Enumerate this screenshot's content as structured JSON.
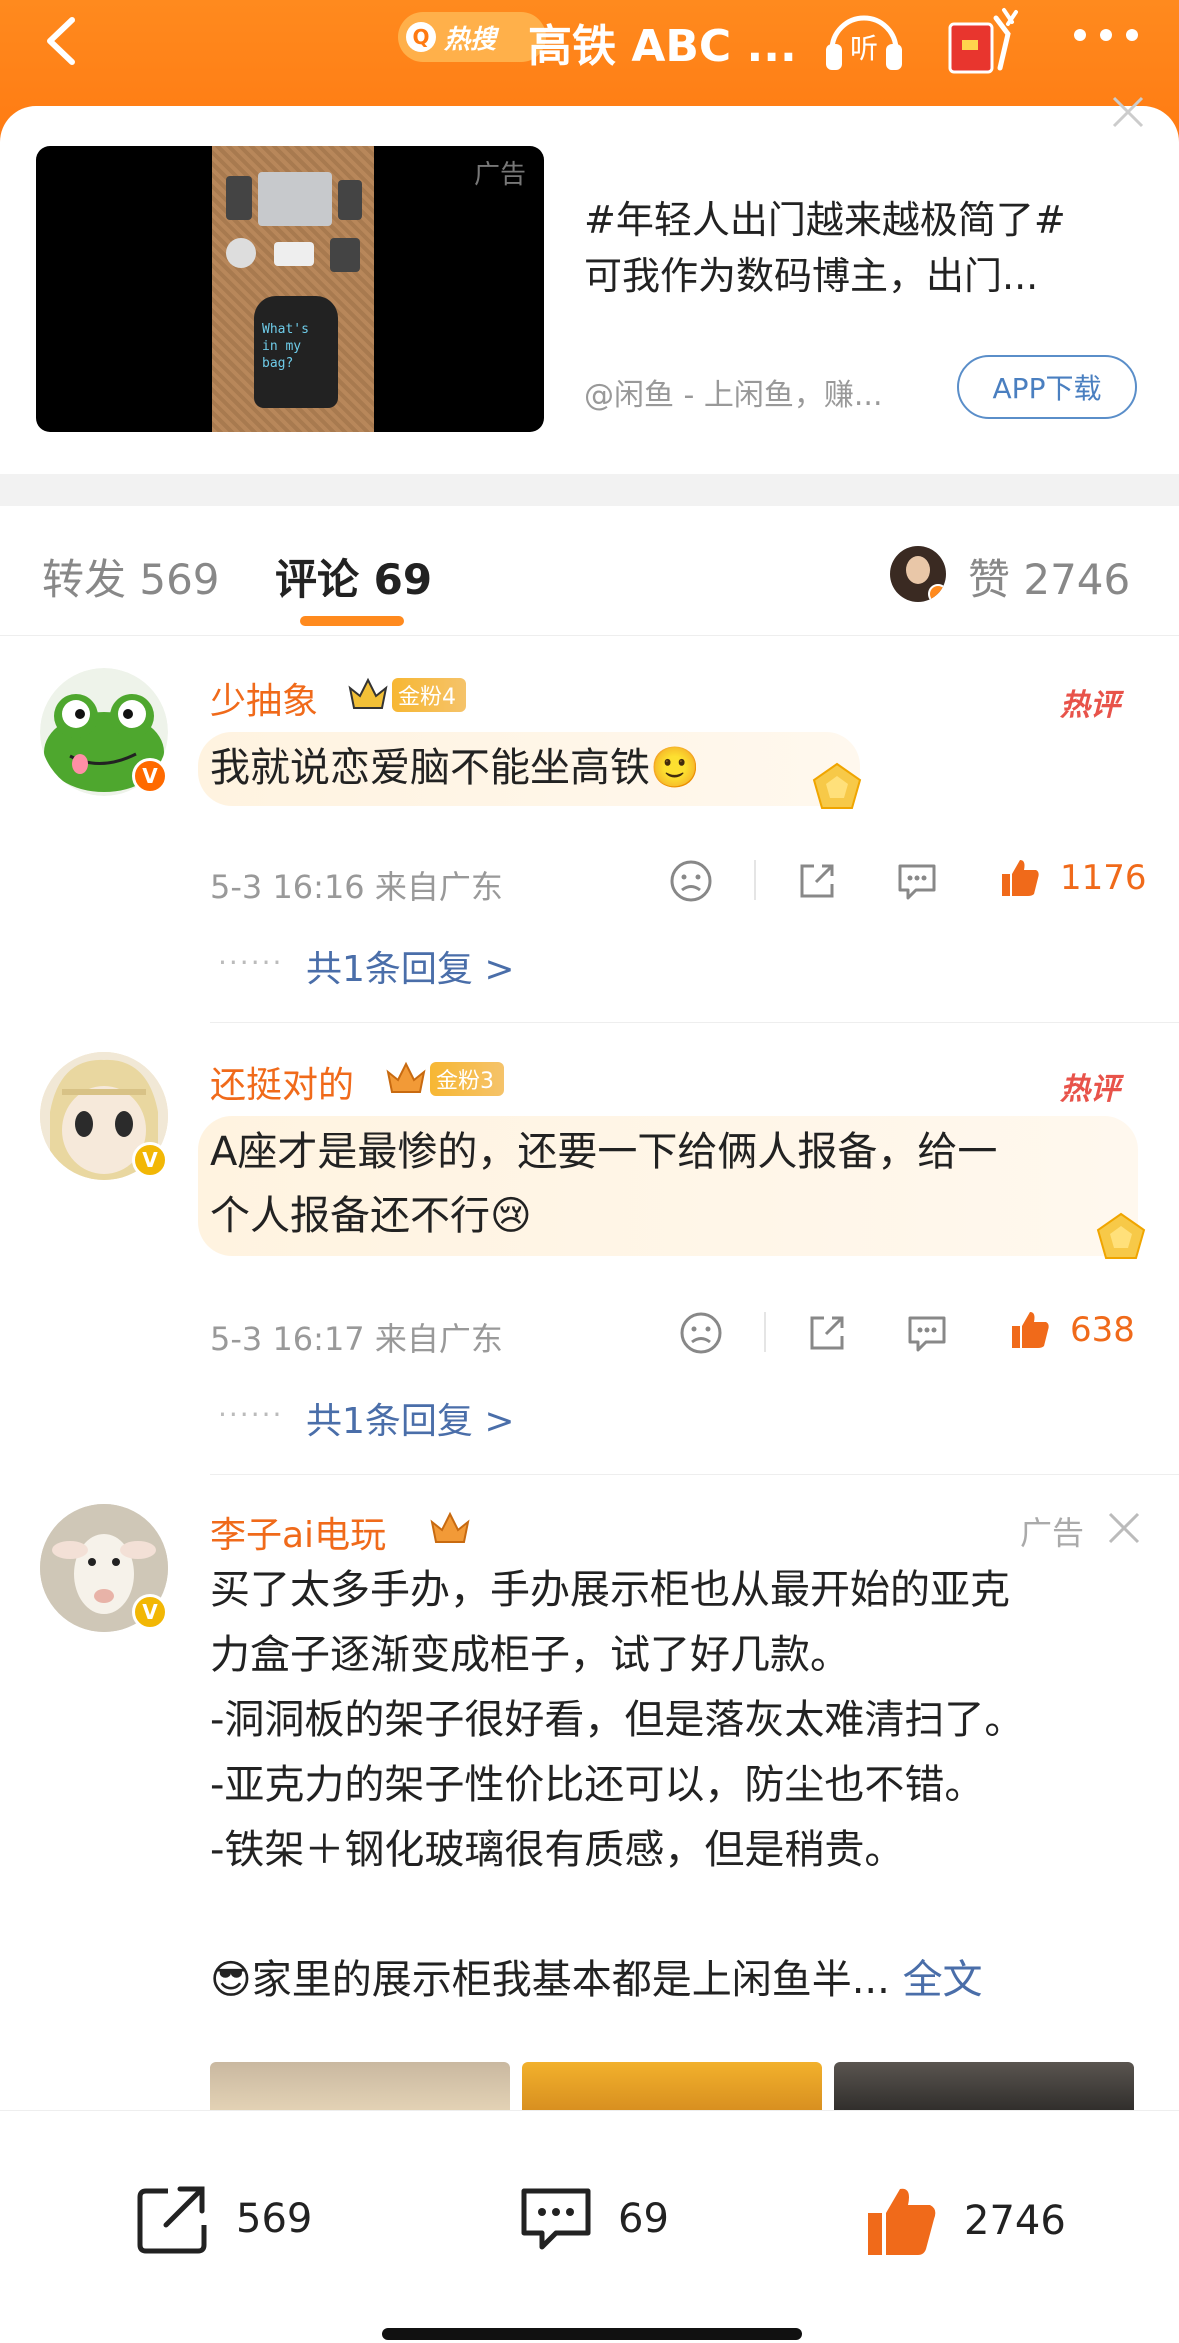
{
  "header": {
    "hot_label": "热搜",
    "title": "高铁 ABC ...",
    "listen_label": "听"
  },
  "ad_card": {
    "tag": "广告",
    "image_text": "What's in my bag?",
    "text_line1": "#年轻人出门越来越极简了#",
    "text_line2": "可我作为数码博主，出门...",
    "source": "@闲鱼 - 上闲鱼，赚...",
    "download_button": "APP下载"
  },
  "tabs": {
    "repost": "转发 569",
    "comment": "评论 69",
    "like": "赞 2746"
  },
  "comments": [
    {
      "username": "少抽象",
      "fan_badge": "金粉4",
      "hot_tag": "热评",
      "text_lines": [
        "我就说恋爱脑不能坐高铁🙂"
      ],
      "meta": "5-3 16:16  来自广东",
      "likes": "1176",
      "replies": "共1条回复 >"
    },
    {
      "username": "还挺对的",
      "fan_badge": "金粉3",
      "hot_tag": "热评",
      "text_lines": [
        "A座才是最惨的，还要一下给俩人报备，给一",
        "个人报备还不行😢"
      ],
      "meta": "5-3 16:17  来自广东",
      "likes": "638",
      "replies": "共1条回复 >"
    },
    {
      "username": "李子ai电玩",
      "ad_label": "广告",
      "text_lines": [
        "买了太多手办，手办展示柜也从最开始的亚克",
        "力盒子逐渐变成柜子，试了好几款。",
        "-洞洞板的架子很好看，但是落灰太难清扫了。",
        "-亚克力的架子性价比还可以，防尘也不错。",
        "-铁架＋钢化玻璃很有质感，但是稍贵。"
      ],
      "last_line": "😎家里的展示柜我基本都是上闲鱼半...",
      "full_text": "全文"
    }
  ],
  "reply_dots": "······",
  "bottom_bar": {
    "repost_count": "569",
    "comment_count": "69",
    "like_count": "2746"
  },
  "colors": {
    "accent": "#ff8a1e",
    "username": "#f06a1a",
    "link": "#4a6ea9",
    "hot": "#e8534a"
  }
}
